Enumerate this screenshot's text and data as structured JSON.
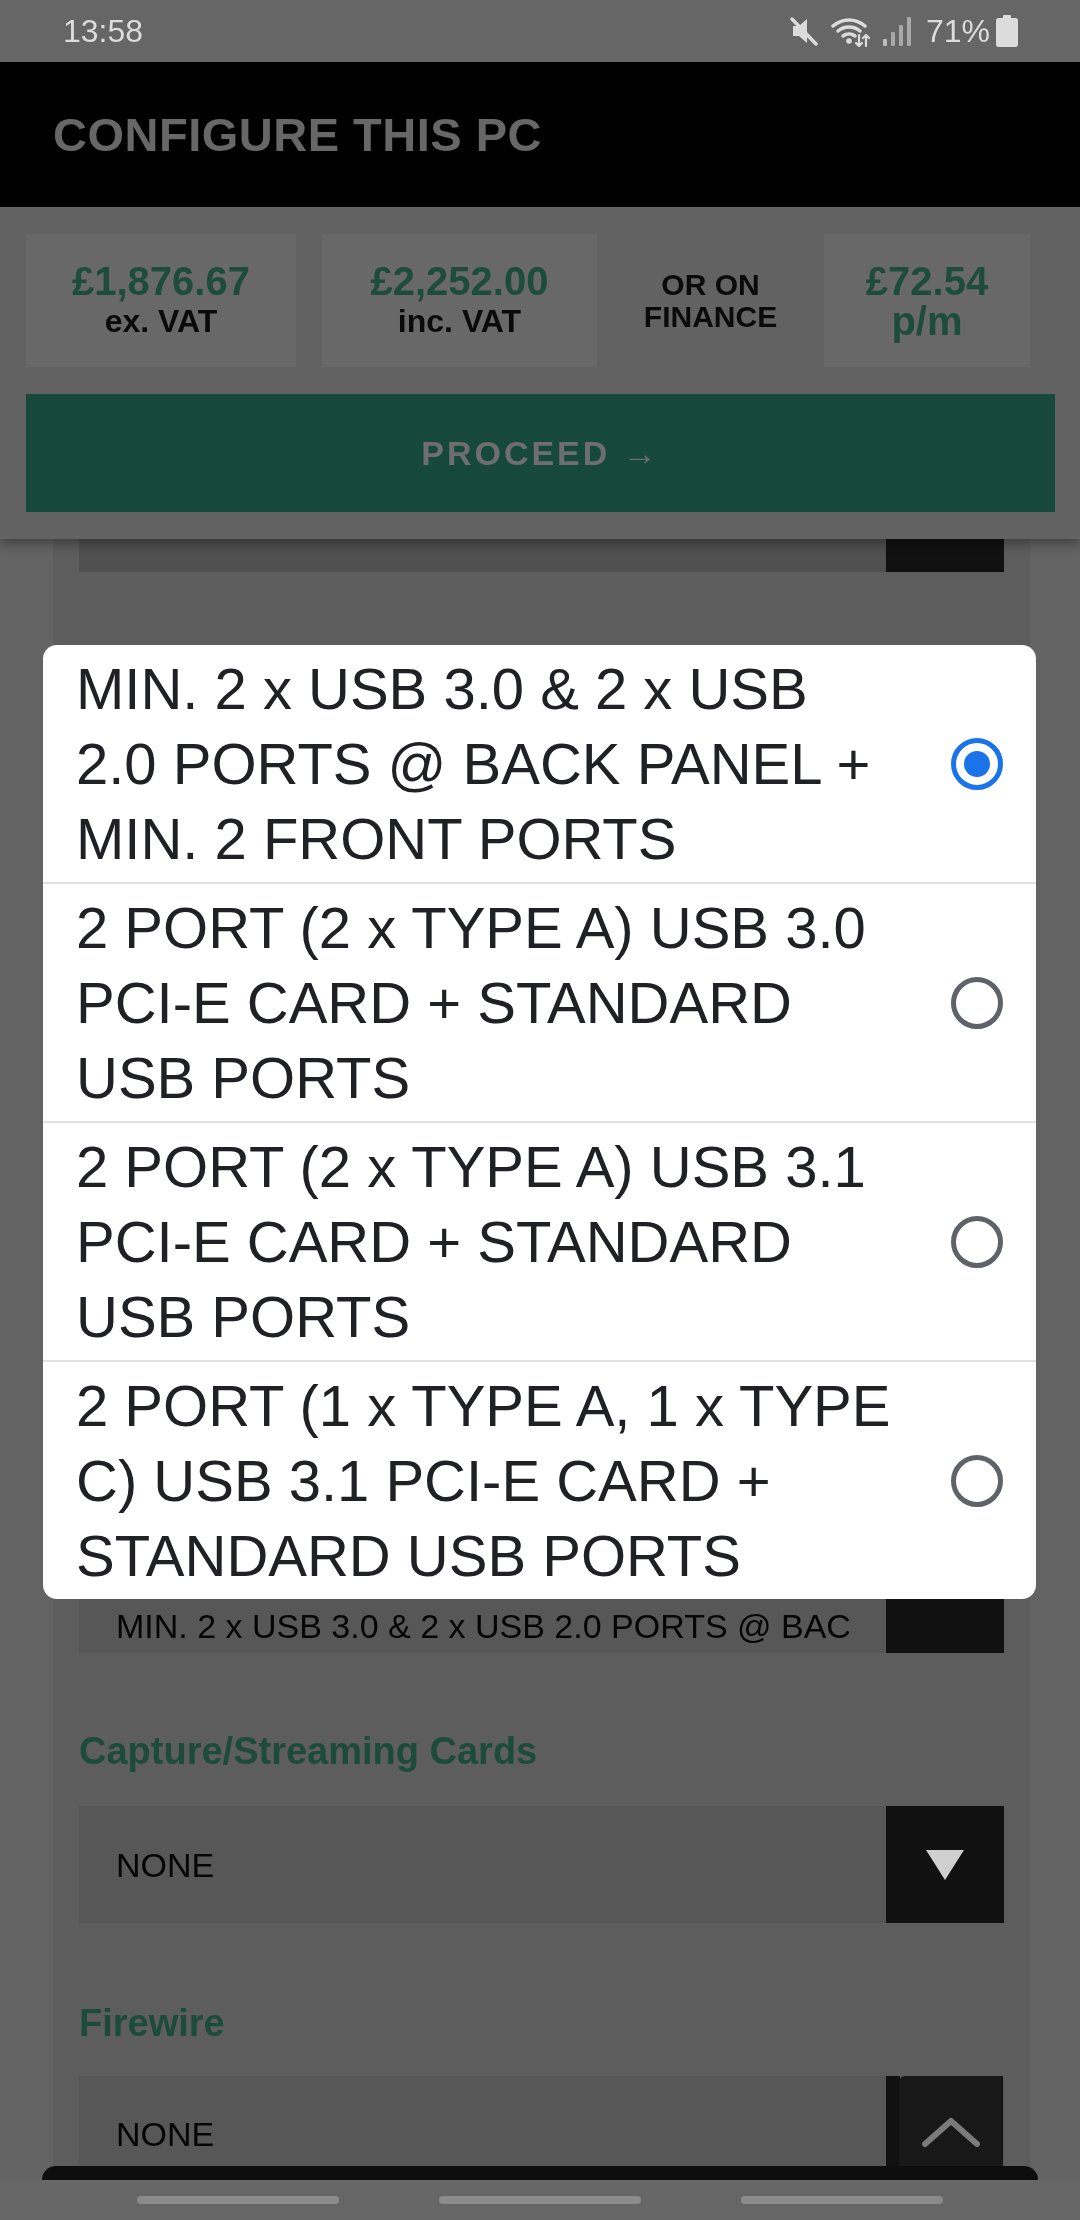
{
  "status_bar": {
    "time": "13:58",
    "battery": "71%"
  },
  "header": {
    "title": "CONFIGURE THIS PC"
  },
  "prices": [
    {
      "kind": "price",
      "amount": "£1,876.67",
      "label": "ex. VAT"
    },
    {
      "kind": "price",
      "amount": "£2,252.00",
      "label": "inc. VAT"
    },
    {
      "kind": "note",
      "label": "OR ON FINANCE"
    },
    {
      "kind": "price",
      "amount": "£72.54 p/m"
    }
  ],
  "proceed_button": {
    "label": "PROCEED →"
  },
  "form": {
    "fields": [
      {
        "value": "MIN. 2 x USB 3.0 & 2 x USB 2.0 PORTS @ BAC"
      },
      {
        "label": "Capture/Streaming Cards",
        "value": "NONE"
      },
      {
        "label": "Firewire",
        "value": "NONE"
      }
    ]
  },
  "dialog": {
    "options": [
      {
        "label": "MIN. 2 x USB 3.0 & 2 x USB 2.0 PORTS @ BACK PANEL + MIN. 2 FRONT PORTS",
        "selected": true
      },
      {
        "label": "2 PORT (2 x TYPE A) USB 3.0 PCI-E CARD + STANDARD USB PORTS",
        "selected": false
      },
      {
        "label": "2 PORT (2 x TYPE A) USB 3.1 PCI-E CARD + STANDARD USB PORTS",
        "selected": false
      },
      {
        "label": "2 PORT (1 x TYPE A, 1 x TYPE C) USB 3.1 PCI-E CARD + STANDARD USB PORTS",
        "selected": false
      }
    ]
  }
}
